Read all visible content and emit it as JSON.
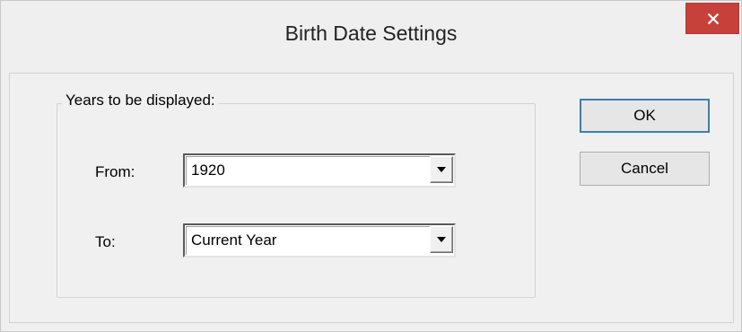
{
  "dialog": {
    "title": "Birth Date Settings",
    "close_icon": "close-icon"
  },
  "group": {
    "label": "Years to be displayed:"
  },
  "from": {
    "label": "From:",
    "value": "1920"
  },
  "to": {
    "label": "To:",
    "value": "Current Year"
  },
  "buttons": {
    "ok_label": "OK",
    "cancel_label": "Cancel"
  },
  "colors": {
    "close_button_bg": "#c7403a",
    "default_button_border": "#3c7fb1",
    "dialog_bg": "#f0f0f0"
  }
}
